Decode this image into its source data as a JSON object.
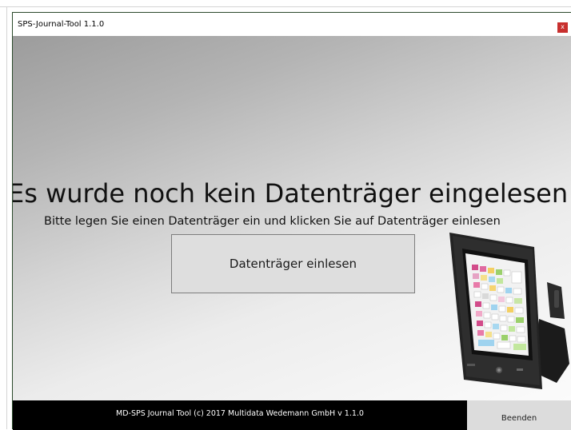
{
  "window": {
    "title": "SPS-Journal-Tool 1.1.0",
    "close_label": "x"
  },
  "main": {
    "headline": "Es wurde noch kein Datenträger eingelesen",
    "instruction": "Bitte legen Sie einen Datenträger ein und klicken Sie auf Datenträger einlesen",
    "read_button_label": "Datenträger einlesen"
  },
  "footer": {
    "copyright": "MD-SPS Journal Tool (c) 2017 Multidata Wedemann GmbH v 1.1.0",
    "quit_label": "Beenden"
  },
  "illustration": {
    "icon": "pos-terminal-icon"
  },
  "colors": {
    "close_button": "#c8302e",
    "footer_background": "#000000",
    "quit_button_background": "#dcdcdc",
    "read_button_background": "#dedede"
  }
}
